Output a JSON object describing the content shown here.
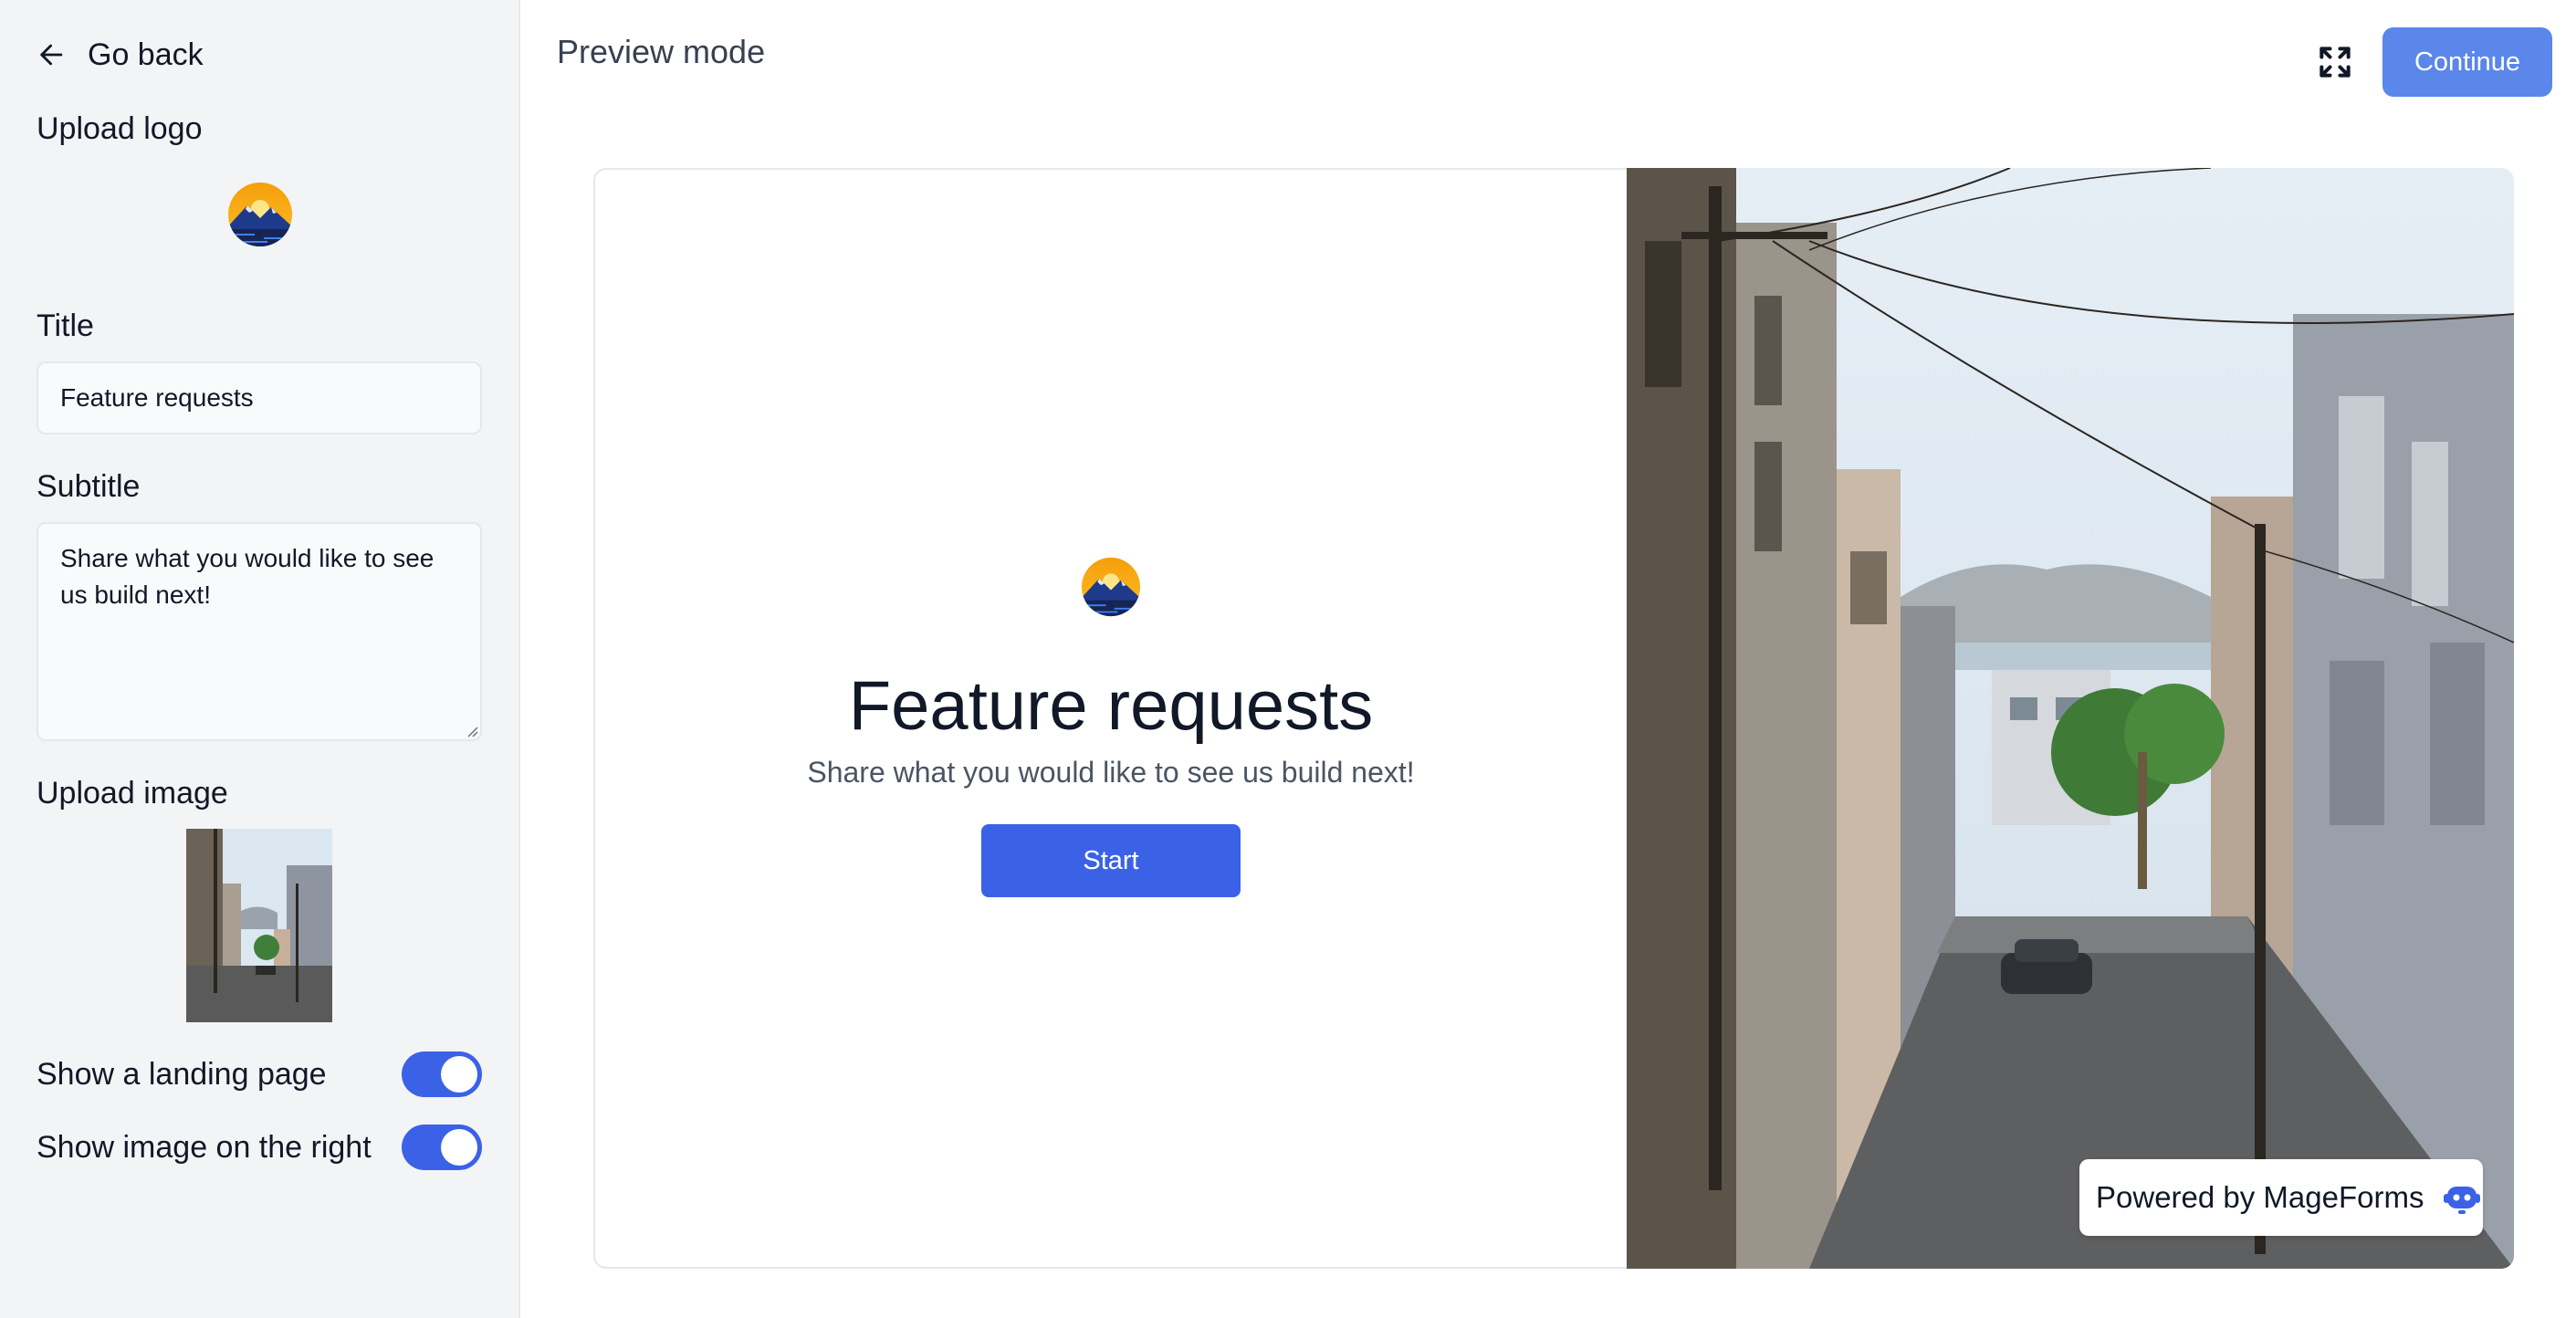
{
  "sidebar": {
    "go_back": "Go back",
    "upload_logo": "Upload logo",
    "title_label": "Title",
    "title_value": "Feature requests",
    "subtitle_label": "Subtitle",
    "subtitle_value": "Share what you would like to see us build next!",
    "upload_image": "Upload image",
    "toggles": [
      {
        "label": "Show a landing page",
        "on": true
      },
      {
        "label": "Show image on the right",
        "on": true
      }
    ]
  },
  "header": {
    "title": "Preview mode",
    "continue_label": "Continue"
  },
  "preview": {
    "title": "Feature requests",
    "subtitle": "Share what you would like to see us build next!",
    "start_label": "Start",
    "powered_by": "Powered by MageForms"
  },
  "icons": {
    "back": "arrow-left-icon",
    "expand": "expand-icon",
    "brand": "mageforms-robot-icon",
    "logo": "mountain-sunset-logo"
  },
  "colors": {
    "accent": "#3b62e6",
    "continue": "#5b86ea",
    "sidebar_bg": "#f3f4f6"
  }
}
